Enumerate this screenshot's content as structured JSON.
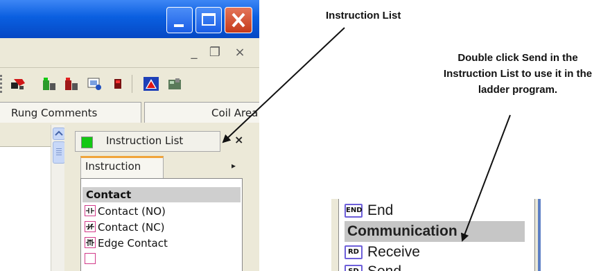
{
  "left_window": {
    "mdi_controls": [
      "_",
      "❐",
      "×"
    ],
    "column_tabs": [
      "Rung Comments",
      "Coil Area"
    ],
    "panel": {
      "title": "Instruction List",
      "close_glyph": "×",
      "tab_label": "Instruction",
      "tab_arrow": "▸",
      "category": "Contact",
      "items": [
        {
          "label": "Contact (NO)",
          "icon": "contact-no-icon"
        },
        {
          "label": "Contact (NC)",
          "icon": "contact-nc-icon"
        },
        {
          "label": "Edge Contact",
          "icon": "edge-contact-icon"
        }
      ]
    }
  },
  "zoom_list": {
    "items": [
      {
        "badge": "END",
        "label": "End"
      },
      {
        "category": "Communication"
      },
      {
        "badge": "RD",
        "label": "Receive"
      },
      {
        "badge": "SD",
        "label": "Send"
      }
    ]
  },
  "annotations": {
    "instruction_list_label": "Instruction List",
    "double_click_note": [
      "Double click Send in the",
      "Instruction List to use it in the",
      "ladder program."
    ]
  },
  "colors": {
    "titlebar": "#0a5fe0",
    "close_button": "#c53a1a",
    "panel_accent": "#f0a43a",
    "badge_border": "#6d5fd9"
  }
}
